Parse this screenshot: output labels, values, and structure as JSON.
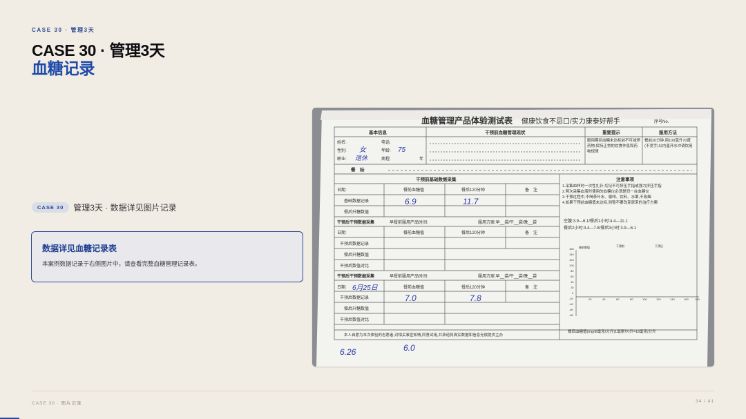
{
  "header": {
    "eyebrow": "CASE 30 · 管理3天",
    "title_line1": "CASE 30 · 管理3天",
    "title_line2": "血糖记录"
  },
  "tagline": {
    "badge": "CASE 30",
    "text": "管理3天 · 数据详见图片记录"
  },
  "card": {
    "title": "数据详见血糖记录表",
    "body": "本案例数据记录于右侧图片中，请查看完整血糖管理记录表。"
  },
  "photo": {
    "form_title": "血糖管理产品体验测试表",
    "form_slogan": "健康饮食不忌口/实力康泰好帮手",
    "serial_label": "序号No.",
    "sections": {
      "basic_info": "基本信息",
      "pre_status": "干预前血糖管理现状",
      "key_tips": "重要提示",
      "usage": "服用方法",
      "base_data": "干预前基础数据采集",
      "notes": "注意事项",
      "during_data": "干预后干预数据采集",
      "during_data_2": "干预后干预数据采集"
    },
    "labels": {
      "name": "姓名:",
      "phone": "电话:",
      "gender": "性别:",
      "age": "年龄:",
      "job": "职业:",
      "illness": "病程:",
      "year": "年",
      "meal": "餐　标",
      "date": "日期:",
      "month": "月",
      "day": "日",
      "before_meal": "餐前血糖值",
      "after_meal": "餐后120分钟",
      "remark": "备　注",
      "base_record": "基础数据记录",
      "rise_value": "餐后升糖数值",
      "during_record": "干预后数据记录",
      "compare": "干预后数值对比",
      "breakfast_time": "早餐前服用产品时间:",
      "plan": "服用方案:早__袋/午__袋/晚__袋",
      "tip_text": "服用期间血糖未达标前不可减停药物;保持正常的饮食作息和药物规律",
      "usage_text": "餐前20分钟,用100毫升70度(不烫手)以内温开水冲调饮用",
      "note1": "1.采集血样时一次性扎针,切记不可挤压手指或强力挤压手指",
      "note2": "2.两次采集血液时使用的血糖仪必须是同一台血糖仪",
      "note3": "3.干预过程中,不喝茶叶水、咖啡、饮料、水果,不吸烟",
      "note4": "4.如果干预前血糖值未达标,则暂不要改变原来的治疗方案",
      "range1": "空腹:3.9—6.1/餐后1小时:4.4—11.1",
      "range2": "餐后2小时:4.4—7.8/餐后3小时:3.9—6.1",
      "legend1": "餐前数值",
      "legend2": "干预前",
      "legend3": "干预后",
      "footer_text": "本人自愿为本次体验的志愿者,对相关事宜知情,同意试用,并承诺将真实数据和信息无偿提供主办",
      "unit_text": "餐后血糖值(mg/dl毫克/分升)1毫摩尔/升=18毫克/分升"
    },
    "handwriting": {
      "gender": "女",
      "age": "75",
      "job": "退休",
      "base_before": "6.9",
      "base_after": "11.7",
      "date3": "6月25日",
      "r3_before": "7.0",
      "r3_after": "7.8",
      "bottom_left": "6.26",
      "bottom_mid": "6.0"
    },
    "chart_axis": {
      "y": [
        "160",
        "140",
        "120",
        "100",
        "80",
        "60",
        "40",
        "20",
        "0",
        "-20",
        "-40",
        "-60",
        "-80"
      ],
      "x": [
        "20",
        "40",
        "60",
        "80",
        "100",
        "120",
        "140",
        "160",
        "180"
      ]
    }
  },
  "footer": {
    "left": "CASE 30 · 图片记录",
    "right": "34 / 41"
  }
}
